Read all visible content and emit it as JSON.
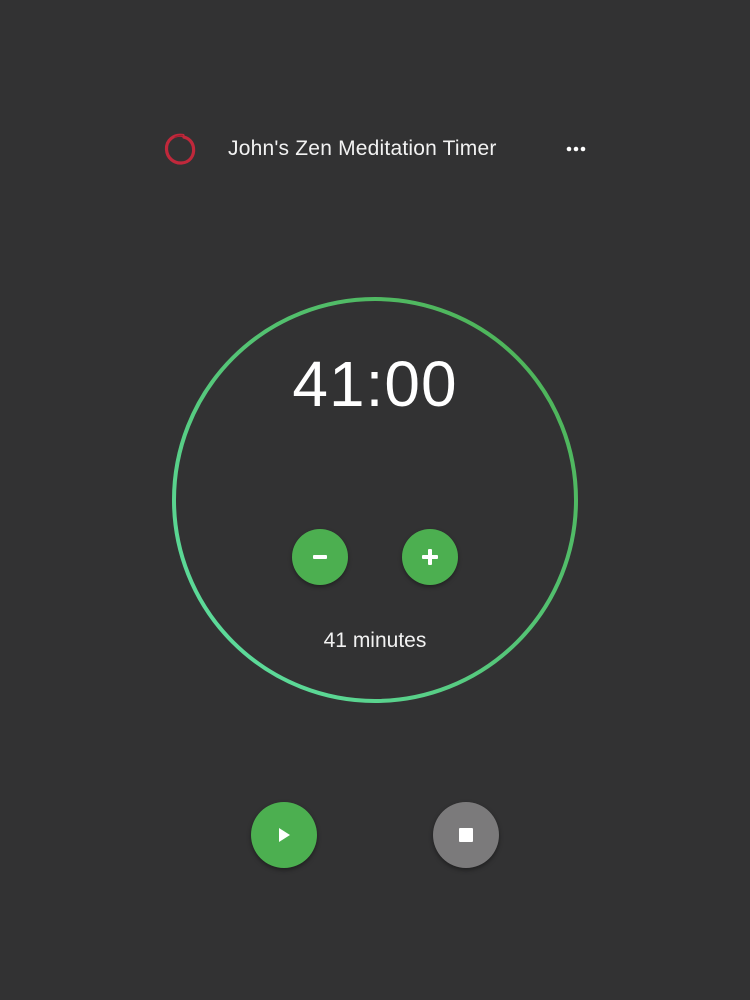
{
  "header": {
    "title": "John's Zen Meditation Timer",
    "logo_icon": "enso-circle-icon",
    "menu_icon": "more-horizontal-icon"
  },
  "timer": {
    "display": "41:00",
    "minutes_label": "41 minutes",
    "progress_fraction": 1.0
  },
  "controls": {
    "decrease_icon": "minus-icon",
    "increase_icon": "plus-icon",
    "play_icon": "play-icon",
    "stop_icon": "stop-icon"
  },
  "colors": {
    "background": "#323233",
    "accent": "#4caf50",
    "ring_start": "#5fe3a8",
    "ring_end": "#4caf50",
    "stop_button": "#7b7a7b",
    "logo": "#c0283b"
  }
}
